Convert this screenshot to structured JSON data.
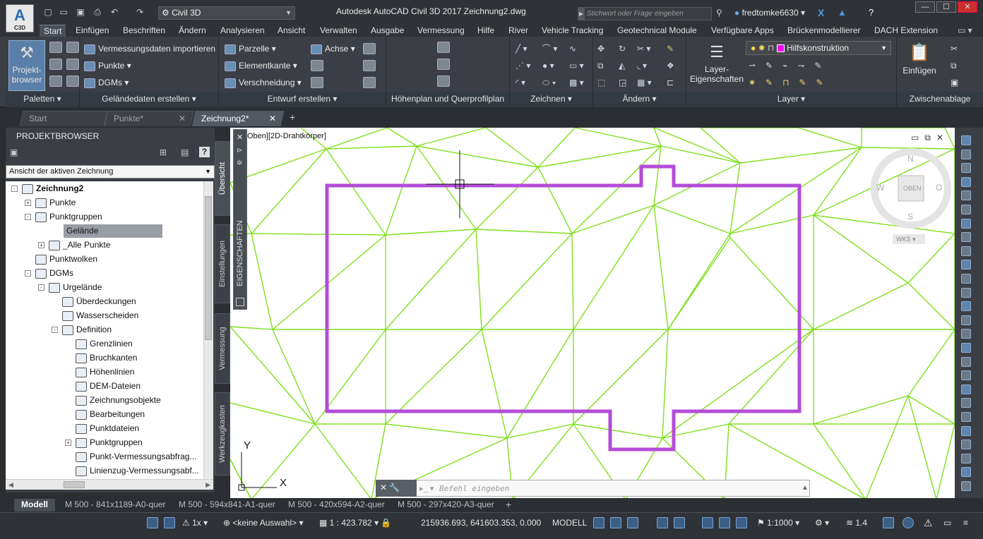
{
  "app": {
    "logo": "A",
    "logo_sub": "C3D",
    "workspace": "Civil 3D",
    "window_title": "Autodesk AutoCAD Civil 3D 2017     Zeichnung2.dwg",
    "search_placeholder": "Stichwort oder Frage eingeben",
    "user": "fredtomke6630"
  },
  "ribbon_tabs": [
    "Start",
    "Einfügen",
    "Beschriften",
    "Ändern",
    "Analysieren",
    "Ansicht",
    "Verwalten",
    "Ausgabe",
    "Vermessung",
    "Hilfe",
    "River",
    "Vehicle Tracking",
    "Geotechnical Module",
    "Verfügbare Apps",
    "Brückenmodellierer",
    "DACH Extension"
  ],
  "ribbon": {
    "paletten": {
      "title": "Paletten",
      "button": "Projekt-browser"
    },
    "gelaende": {
      "title": "Geländedaten erstellen",
      "import": "Vermessungsdaten importieren",
      "punkte": "Punkte",
      "dgms": "DGMs"
    },
    "entwurf": {
      "title": "Entwurf erstellen",
      "parzelle": "Parzelle",
      "achse": "Achse",
      "elementkante": "Elementkante",
      "verschneidung": "Verschneidung"
    },
    "hoehenplan": {
      "title": "Höhenplan und Querprofilplan"
    },
    "zeichnen": {
      "title": "Zeichnen"
    },
    "aendern": {
      "title": "Ändern"
    },
    "layer": {
      "title": "Layer",
      "props": "Layer-Eigenschaften",
      "current": "Hilfskonstruktion",
      "current_color": "#ff00ff"
    },
    "clipboard": {
      "title": "Zwischenablage",
      "paste": "Einfügen"
    }
  },
  "doc_tabs": [
    {
      "label": "Start"
    },
    {
      "label": "Punkte*"
    },
    {
      "label": "Zeichnung2*"
    }
  ],
  "browser": {
    "title": "PROJEKTBROWSER",
    "view": "Ansicht der aktiven Zeichnung",
    "tree": [
      {
        "label": "Zeichnung2",
        "level": 0,
        "bold": true,
        "exp": "-"
      },
      {
        "label": "Punkte",
        "level": 1,
        "exp": "+"
      },
      {
        "label": "Punktgruppen",
        "level": 1,
        "exp": "-"
      },
      {
        "label": "Gelände",
        "level": 2,
        "exp": "+",
        "selected": true
      },
      {
        "label": "_Alle Punkte",
        "level": 2,
        "exp": "+"
      },
      {
        "label": "Punktwolken",
        "level": 1,
        "exp": ""
      },
      {
        "label": "DGMs",
        "level": 1,
        "exp": "-"
      },
      {
        "label": "Urgelände",
        "level": 2,
        "exp": "-"
      },
      {
        "label": "Überdeckungen",
        "level": 3,
        "exp": ""
      },
      {
        "label": "Wasserscheiden",
        "level": 3,
        "exp": ""
      },
      {
        "label": "Definition",
        "level": 3,
        "exp": "-"
      },
      {
        "label": "Grenzlinien",
        "level": 4,
        "exp": ""
      },
      {
        "label": "Bruchkanten",
        "level": 4,
        "exp": ""
      },
      {
        "label": "Höhenlinien",
        "level": 4,
        "exp": ""
      },
      {
        "label": "DEM-Dateien",
        "level": 4,
        "exp": ""
      },
      {
        "label": "Zeichnungsobjekte",
        "level": 4,
        "exp": ""
      },
      {
        "label": "Bearbeitungen",
        "level": 4,
        "exp": ""
      },
      {
        "label": "Punktdateien",
        "level": 4,
        "exp": ""
      },
      {
        "label": "Punktgruppen",
        "level": 4,
        "exp": "+"
      },
      {
        "label": "Punkt-Vermessungsabfrag...",
        "level": 4,
        "exp": ""
      },
      {
        "label": "Linienzug-Vermessungsabf...",
        "level": 4,
        "exp": ""
      }
    ]
  },
  "side_tabs": [
    "Übersicht",
    "Einstellungen",
    "Vermessung",
    "Werkzeugkasten"
  ],
  "properties_palette": "EIGENSCHAFTEN",
  "viewport": {
    "label": "Oben][2D-Drahtkörper]",
    "viewcube": {
      "top": "OBEN",
      "n": "N",
      "s": "S",
      "w": "W",
      "o": "O",
      "wks": "WKS"
    },
    "ucs_x": "X",
    "ucs_y": "Y",
    "surface_color": "#7fe01e",
    "outline_color": "#b44cd8"
  },
  "command": {
    "placeholder": "Befehl eingeben"
  },
  "layout_tabs": [
    "Modell",
    "M 500 - 841x1189-A0-quer",
    "M 500 - 594x841-A1-quer",
    "M 500 - 420x594-A2-quer",
    "M 500 - 297x420-A3-quer"
  ],
  "status": {
    "snap": "1x",
    "selection": "<keine Auswahl>",
    "scale": "1 : 423.782",
    "coords": "215936.693, 641603.353, 0.000",
    "mode": "MODELL",
    "annoscale": "1:1000",
    "lw": "1.4"
  }
}
